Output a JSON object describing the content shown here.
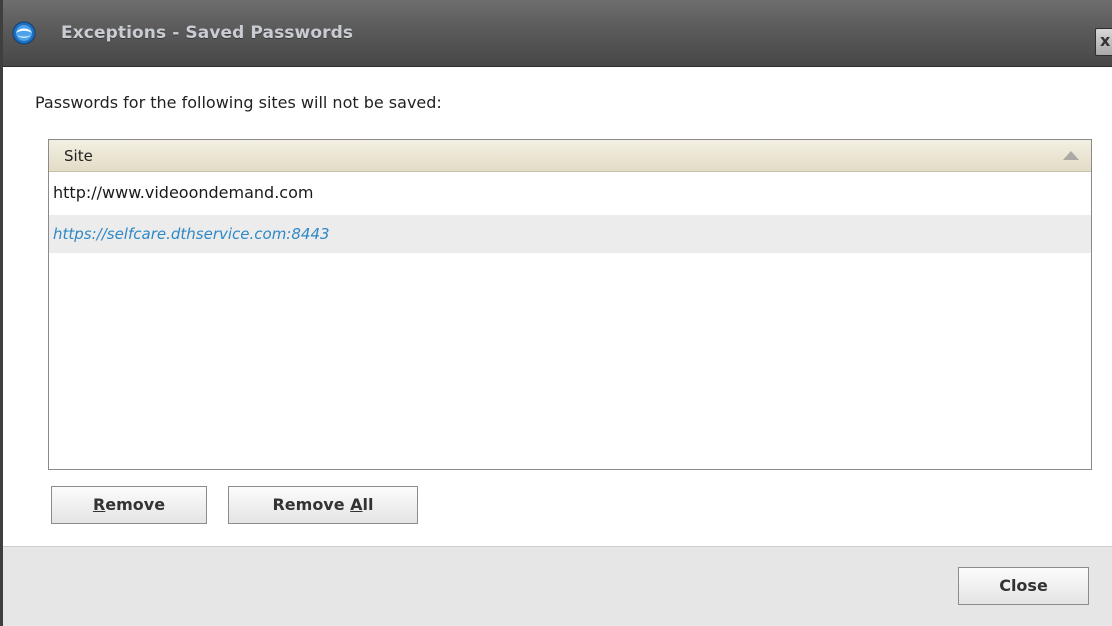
{
  "window": {
    "title": "Exceptions - Saved Passwords",
    "close_glyph": "x",
    "icon": "browser-logo-icon"
  },
  "prompt": "Passwords for the following sites will not be saved:",
  "table": {
    "columns": [
      "Site"
    ],
    "sort": "ascending",
    "rows": [
      {
        "site": "http://www.videoondemand.com",
        "selected": false
      },
      {
        "site": "https://selfcare.dthservice.com:8443",
        "selected": true
      }
    ]
  },
  "buttons": {
    "remove": {
      "pre": "",
      "accel": "R",
      "post": "emove"
    },
    "remove_all": {
      "pre": "Remove ",
      "accel": "A",
      "post": "ll"
    },
    "close": "Close"
  },
  "colors": {
    "titlebar": "#5a5a5a",
    "selected_row_text": "#2e88c6",
    "footer": "#e6e6e6"
  }
}
